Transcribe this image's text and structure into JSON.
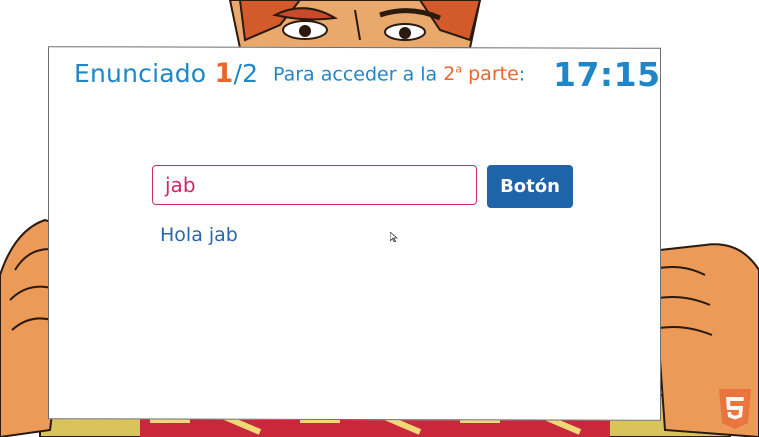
{
  "header": {
    "statement_label": "Enunciado",
    "statement_current": "1",
    "statement_total": "/2",
    "access_text": "Para acceder a la",
    "part_number": "2",
    "part_ordinal": "a",
    "part_label": "parte",
    "colon": ":",
    "timer": "17:15"
  },
  "form": {
    "input_value": "jab",
    "button_label": "Botón",
    "greeting": "Hola jab"
  },
  "colors": {
    "accent_blue": "#1f86c7",
    "accent_orange": "#e8672f",
    "input_border": "#cc2a66",
    "button_bg": "#1f63a8"
  },
  "icons": {
    "badge": "html5-icon",
    "pointer": "mouse-cursor-icon"
  }
}
